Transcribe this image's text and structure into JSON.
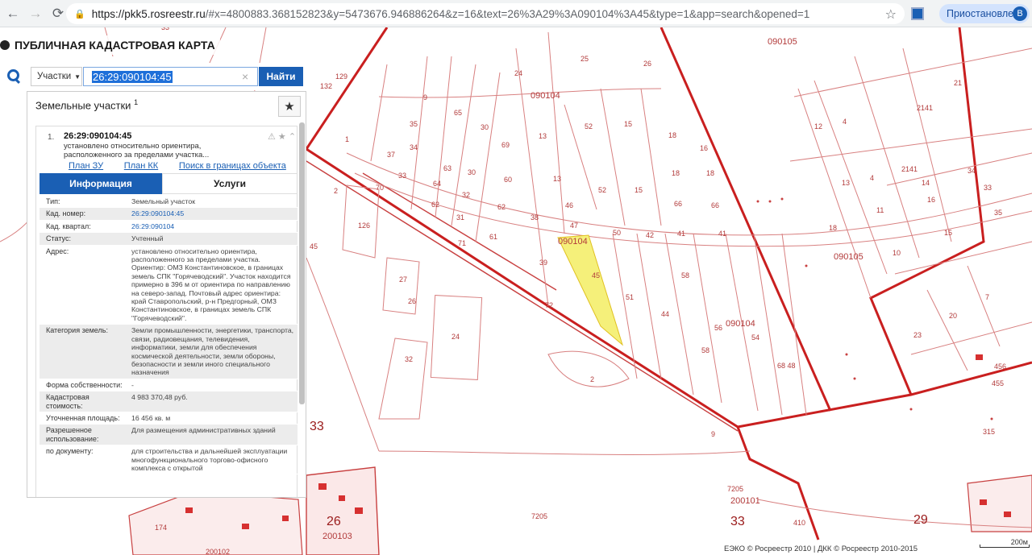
{
  "browser": {
    "url_host": "https://pkk5.rosreestr.ru",
    "url_rest": "/#x=4800883.368152823&y=5473676.946886264&z=16&text=26%3A29%3A090104%3A45&type=1&app=search&opened=1",
    "paused_label": "Приостановлена",
    "avatar_letter": "В"
  },
  "app": {
    "title": "ПУБЛИЧНАЯ КАДАСТРОВАЯ КАРТА"
  },
  "search": {
    "type_label": "Участки",
    "query": "26:29:090104:45",
    "find_label": "Найти"
  },
  "panel": {
    "title": "Земельные участки",
    "title_sup": "1",
    "item": {
      "num": "1.",
      "cad": "26:29:090104:45",
      "desc": "установлено относительно ориентира, расположенного за пределами участка..."
    },
    "links": [
      "План ЗУ →",
      "План КК →",
      "Поиск в границах объекта →"
    ],
    "tabs": {
      "info": "Информация",
      "services": "Услуги"
    },
    "props": [
      {
        "k": "Тип:",
        "v": "Земельный участок"
      },
      {
        "k": "Кад. номер:",
        "v": "26:29:090104:45"
      },
      {
        "k": "Кад. квартал:",
        "v": "26:29:090104"
      },
      {
        "k": "Статус:",
        "v": "Учтенный"
      },
      {
        "k": "Адрес:",
        "v": "установлено относительно ориентира, расположенного за пределами участка. Ориентир: ОМЗ Константиновское, в границах земель СПК \"Горячеводский\". Участок находится примерно в 396 м от ориентира по направлению на северо-запад. Почтовый адрес ориентира: край Ставропольский, р-н Предгорный, ОМЗ Константиновское, в границах земель СПК \"Горячеводский\"."
      },
      {
        "k": "Категория земель:",
        "v": "Земли промышленности, энергетики, транспорта, связи, радиовещания, телевидения, информатики, земли для обеспечения космической деятельности, земли обороны, безопасности и земли иного специального назначения"
      },
      {
        "k": "Форма собственности:",
        "v": "-"
      },
      {
        "k": "Кадастровая стоимость:",
        "v": "4 983 370,48 руб."
      },
      {
        "k": "Уточненная площадь:",
        "v": "16 456 кв. м"
      },
      {
        "k": "Разрешенное использование:",
        "v": "Для размещения административных зданий"
      },
      {
        "k": "по документу:",
        "v": "для строительства и дальнейшей эксплуатации многофункционального торгово-офисного комплекса с открытой"
      }
    ]
  },
  "map": {
    "labels": [
      {
        "t": "33"
      },
      {
        "t": "090105"
      },
      {
        "t": "132"
      },
      {
        "t": "129"
      },
      {
        "t": "24"
      },
      {
        "t": "25"
      },
      {
        "t": "26"
      },
      {
        "t": "090104"
      },
      {
        "t": "9"
      },
      {
        "t": "65"
      },
      {
        "t": "35"
      },
      {
        "t": "30"
      },
      {
        "t": "13"
      },
      {
        "t": "52"
      },
      {
        "t": "15"
      },
      {
        "t": "18"
      },
      {
        "t": "16"
      },
      {
        "t": "69"
      },
      {
        "t": "34"
      },
      {
        "t": "37"
      },
      {
        "t": "1"
      },
      {
        "t": "33"
      },
      {
        "t": "63"
      },
      {
        "t": "30"
      },
      {
        "t": "60"
      },
      {
        "t": "13"
      },
      {
        "t": "18"
      },
      {
        "t": "18"
      },
      {
        "t": "70"
      },
      {
        "t": "64"
      },
      {
        "t": "32"
      },
      {
        "t": "52"
      },
      {
        "t": "15"
      },
      {
        "t": "66"
      },
      {
        "t": "66"
      },
      {
        "t": "2"
      },
      {
        "t": "62"
      },
      {
        "t": "62"
      },
      {
        "t": "46"
      },
      {
        "t": "126"
      },
      {
        "t": "31"
      },
      {
        "t": "38"
      },
      {
        "t": "47"
      },
      {
        "t": "50"
      },
      {
        "t": "42"
      },
      {
        "t": "41"
      },
      {
        "t": "41"
      },
      {
        "t": "71"
      },
      {
        "t": "61"
      },
      {
        "t": "090104"
      },
      {
        "t": "45"
      },
      {
        "t": "39"
      },
      {
        "t": "45"
      },
      {
        "t": "58"
      },
      {
        "t": "27"
      },
      {
        "t": "26"
      },
      {
        "t": "72"
      },
      {
        "t": "51"
      },
      {
        "t": "44"
      },
      {
        "t": "56"
      },
      {
        "t": "090104"
      },
      {
        "t": "54"
      },
      {
        "t": "24"
      },
      {
        "t": "58"
      },
      {
        "t": "32"
      },
      {
        "t": "68 48"
      },
      {
        "t": "2"
      },
      {
        "t": "33"
      },
      {
        "t": "9"
      },
      {
        "t": "7205"
      },
      {
        "t": "200101"
      },
      {
        "t": "26"
      },
      {
        "t": "200103"
      },
      {
        "t": "7205"
      },
      {
        "t": "33"
      },
      {
        "t": "410"
      },
      {
        "t": "29"
      },
      {
        "t": "21"
      },
      {
        "t": "2141"
      },
      {
        "t": "12"
      },
      {
        "t": "4"
      },
      {
        "t": "13"
      },
      {
        "t": "2141"
      },
      {
        "t": "14"
      },
      {
        "t": "34"
      },
      {
        "t": "33"
      },
      {
        "t": "16"
      },
      {
        "t": "11"
      },
      {
        "t": "4"
      },
      {
        "t": "35"
      },
      {
        "t": "18"
      },
      {
        "t": "15"
      },
      {
        "t": "090105"
      },
      {
        "t": "10"
      },
      {
        "t": "20"
      },
      {
        "t": "7"
      },
      {
        "t": "23"
      },
      {
        "t": "456"
      },
      {
        "t": "455"
      },
      {
        "t": "315"
      },
      {
        "t": "200102"
      },
      {
        "t": "174"
      }
    ]
  },
  "footer": {
    "copyright": "ЕЭКО © Росреестр 2010 | ДКК © Росреестр 2010-2015",
    "scale": "200м"
  }
}
